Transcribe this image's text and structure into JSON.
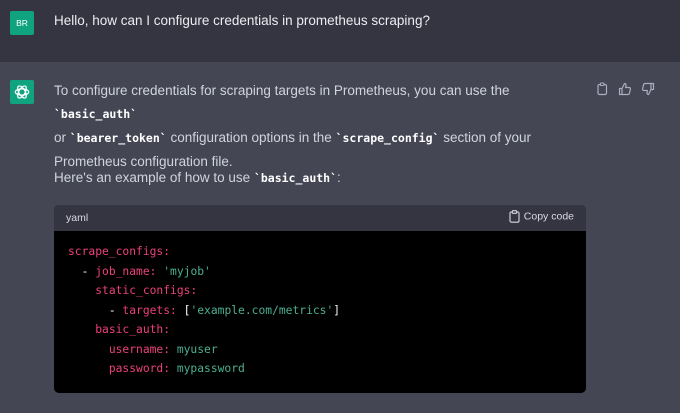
{
  "user": {
    "avatar": "BR",
    "message": "Hello, how can I configure credentials in prometheus scraping?"
  },
  "assistant": {
    "p1_a": "To configure credentials for scraping targets in Prometheus, you can use the ",
    "code_basic_auth": "`basic_auth`",
    "p1_b": "or ",
    "code_bearer_token": "`bearer_token`",
    "p1_c": " configuration options in the ",
    "code_scrape_config": "`scrape_config`",
    "p1_d": " section of your",
    "p1_e": "Prometheus configuration file.",
    "p2_a": "Here's an example of how to use ",
    "p2_code": "`basic_auth`",
    "p2_b": ":",
    "actions": [
      "copy-icon",
      "thumbs-up-icon",
      "thumbs-down-icon"
    ]
  },
  "code": {
    "language": "yaml",
    "copy_label": "Copy code",
    "l1_key": "scrape_configs:",
    "l2_dash": "- ",
    "l2_key": "job_name: ",
    "l2_val": "'myjob'",
    "l3_key": "static_configs:",
    "l4_dash": "- ",
    "l4_key": "targets: ",
    "l4_open": "[",
    "l4_val": "'example.com/metrics'",
    "l4_close": "]",
    "l5_key": "basic_auth:",
    "l6_key": "username: ",
    "l6_val": "myuser",
    "l7_key": "password: ",
    "l7_val": "mypassword"
  },
  "colors": {
    "accent": "#10a37f",
    "key": "#ec407a",
    "string": "#4caf92"
  }
}
